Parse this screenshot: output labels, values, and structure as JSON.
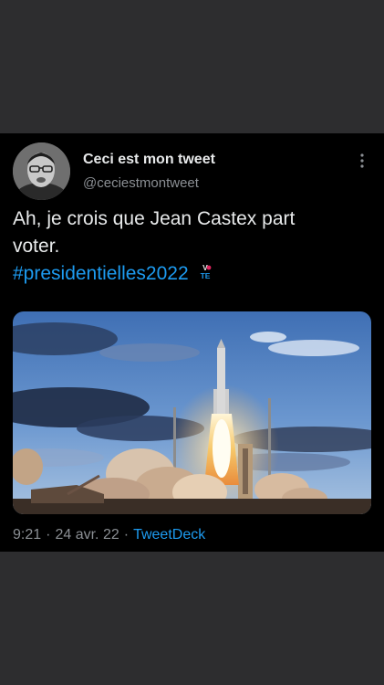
{
  "tweet": {
    "author_name": "Ceci est mon tweet",
    "author_handle": "@ceciestmontweet",
    "text_line1": "Ah, je crois que Jean Castex part",
    "text_line2": "voter.",
    "hashtag": "#presidentielles2022",
    "vote_emoji": "VOTE",
    "media_description_icon": "rocket-launch-photo",
    "time": "9:21",
    "date": "24 avr. 22",
    "separator": "·",
    "source": "TweetDeck"
  },
  "colors": {
    "background": "#000000",
    "frame": "#2d2d2f",
    "text": "#e7e9ea",
    "secondary": "#8b8f94",
    "link": "#1d9bf0"
  },
  "icons": {
    "more": "more-vertical-icon",
    "vote": "vote-emoji-icon"
  }
}
